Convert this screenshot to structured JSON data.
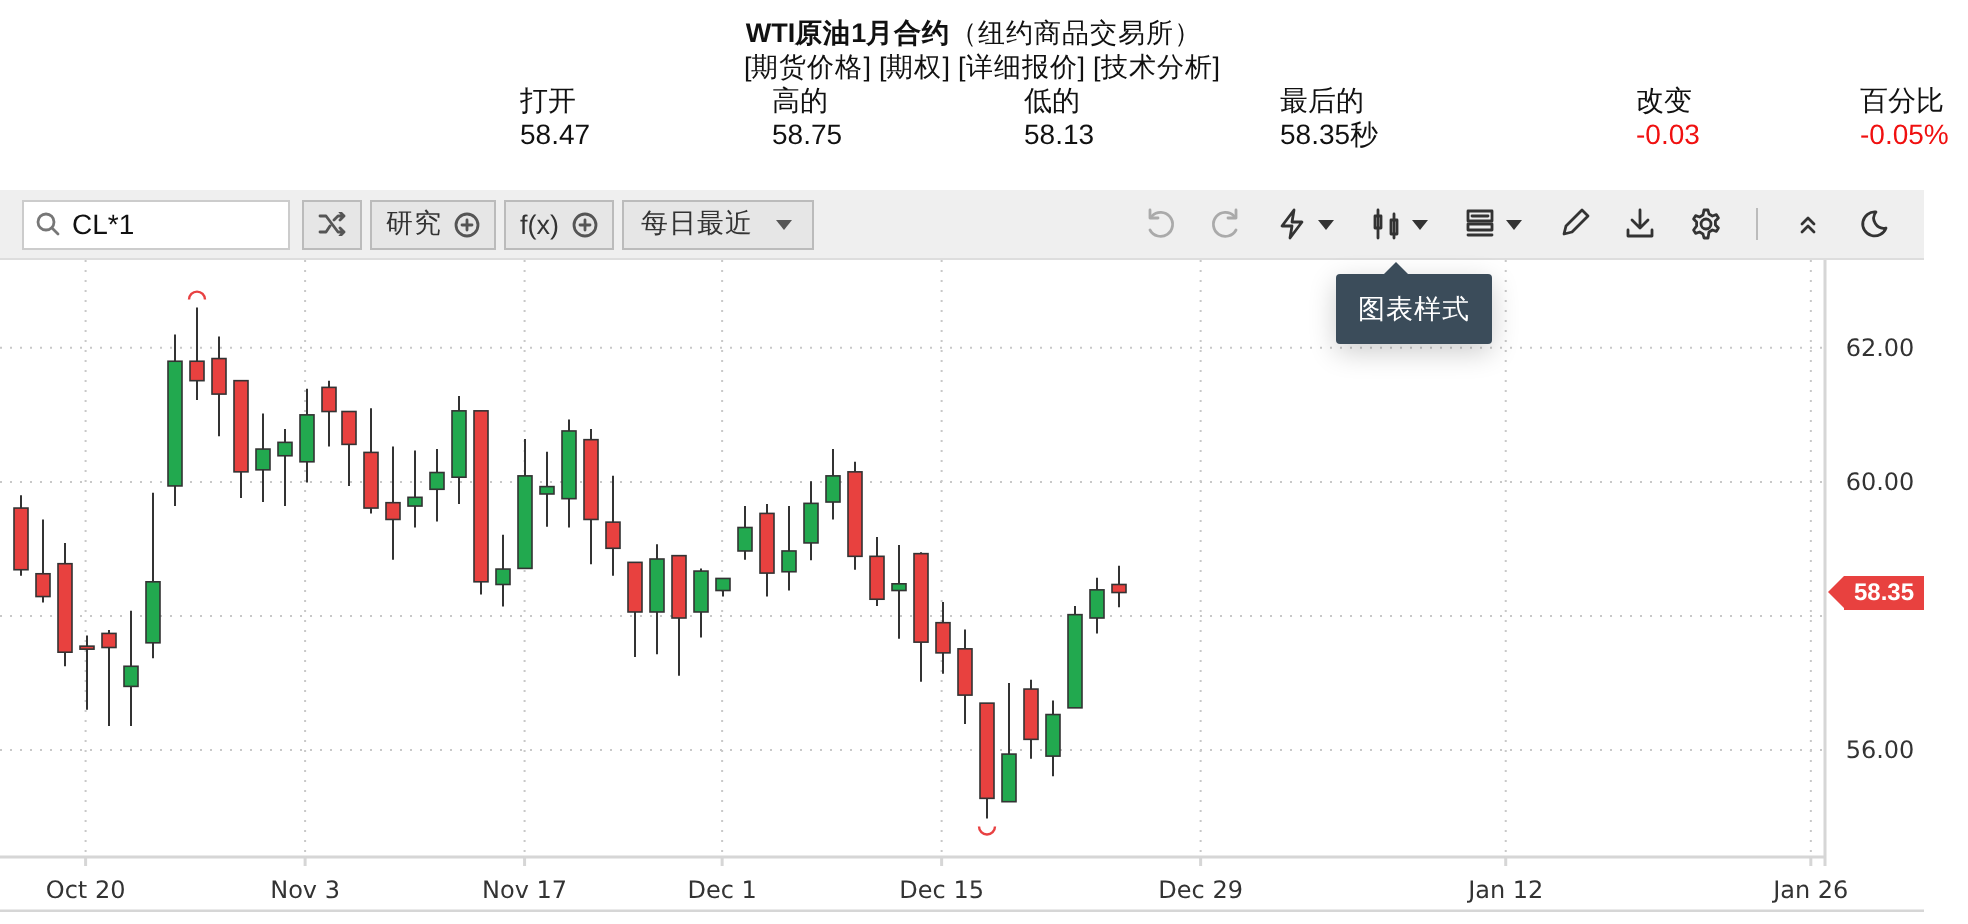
{
  "header": {
    "title": "**WTI原油1月合约**（纽约商品交易所）",
    "links": [
      "[期货价格]",
      "[期权]",
      "[详细报价]",
      "[技术分析]"
    ],
    "stats": [
      {
        "label": "打开",
        "value": "58.47",
        "negative": false
      },
      {
        "label": "高的",
        "value": "58.75",
        "negative": false
      },
      {
        "label": "低的",
        "value": "58.13",
        "negative": false
      },
      {
        "label": "最后的",
        "value": "58.35秒",
        "negative": false
      },
      {
        "label": "改变",
        "value": "-0.03",
        "negative": true
      },
      {
        "label": "百分比",
        "value": "-0.05%",
        "negative": true
      }
    ]
  },
  "toolbar": {
    "search": {
      "value": "CL*1"
    },
    "buttons": [
      {
        "kind": "compare"
      },
      {
        "kind": "add",
        "label": "研究"
      },
      {
        "kind": "add",
        "label": "f(x)"
      },
      {
        "kind": "dropdown",
        "label": "每日最近"
      }
    ],
    "tools": [
      {
        "kind": "undo",
        "disabled": true
      },
      {
        "kind": "redo",
        "disabled": true
      },
      {
        "kind": "lightning",
        "disabled": false
      },
      {
        "kind": "chart-style",
        "disabled": false
      },
      {
        "kind": "layout",
        "disabled": false
      },
      {
        "kind": "draw",
        "disabled": false
      },
      {
        "kind": "download",
        "disabled": false
      },
      {
        "kind": "settings",
        "disabled": false
      },
      {
        "kind": "separator"
      },
      {
        "kind": "collapse",
        "disabled": false
      },
      {
        "kind": "theme",
        "disabled": false
      }
    ],
    "tooltip": "图表样式"
  },
  "chart": {
    "kind": "candlestick",
    "last_price_tag": "58.35",
    "x_axis_labels": [
      "Oct 20",
      "Nov 3",
      "Nov 17",
      "Dec 1",
      "Dec 15",
      "Dec 29",
      "Jan 12",
      "Jan 26"
    ],
    "y_axis_labels": [
      "62.00",
      "60.00",
      "56.00"
    ]
  }
}
